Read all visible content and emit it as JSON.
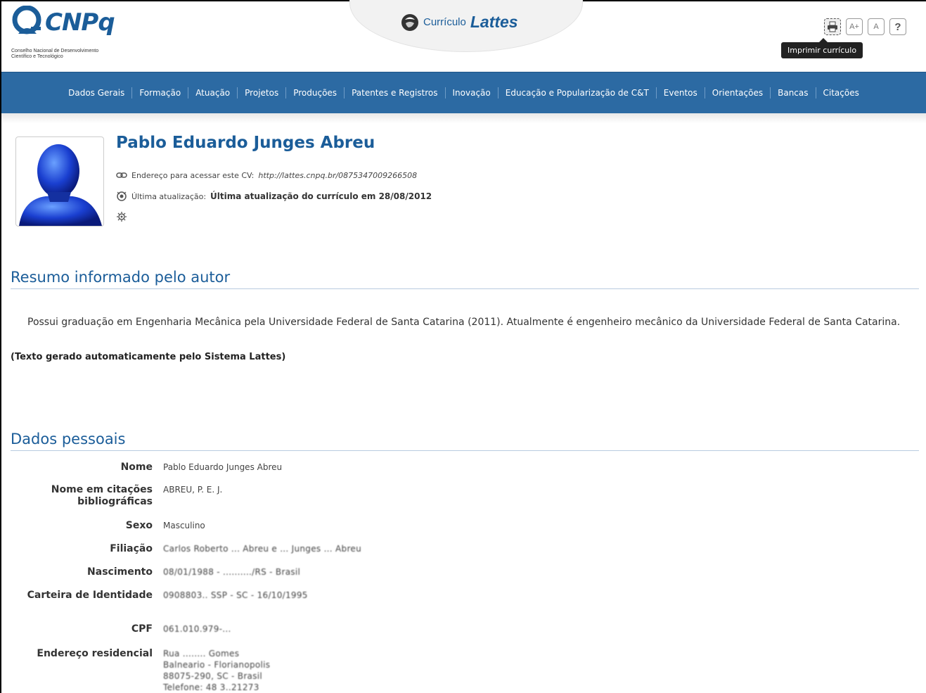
{
  "header": {
    "logo_text": "CNPq",
    "logo_subtitle_1": "Conselho Nacional de Desenvolvimento",
    "logo_subtitle_2": "Científico e Tecnológico",
    "app_title_prefix": "Currículo",
    "app_title_main": "Lattes",
    "tools": [
      {
        "name": "print",
        "label": ""
      },
      {
        "name": "font-increase",
        "label": "A+"
      },
      {
        "name": "font-default",
        "label": "A"
      },
      {
        "name": "help",
        "label": "?"
      }
    ],
    "tooltip": "Imprimir currículo"
  },
  "nav": {
    "items": [
      "Dados Gerais",
      "Formação",
      "Atuação",
      "Projetos",
      "Produções",
      "Patentes e Registros",
      "Inovação",
      "Educação e Popularização de C&T",
      "Eventos",
      "Orientações",
      "Bancas",
      "Citações"
    ]
  },
  "profile": {
    "name": "Pablo Eduardo Junges Abreu",
    "url_label": "Endereço para acessar este CV:",
    "url": "http://lattes.cnpq.br/0875347009266508",
    "update_label": "Última atualização:",
    "update_value": "Última atualização do currículo em 28/08/2012"
  },
  "resumo": {
    "title": "Resumo informado pelo autor",
    "text": "Possui graduação em Engenharia Mecânica pela Universidade Federal de Santa Catarina (2011). Atualmente é engenheiro mecânico da Universidade Federal de Santa Catarina.",
    "auto_note": "(Texto gerado automaticamente pelo Sistema Lattes)"
  },
  "dados": {
    "title": "Dados pessoais",
    "rows": [
      {
        "key": "Nome",
        "value": "Pablo Eduardo Junges Abreu"
      },
      {
        "key": "Nome em citações bibliográficas",
        "value": "ABREU, P. E. J."
      },
      {
        "key": "Sexo",
        "value": "Masculino"
      },
      {
        "key": "Filiação",
        "value": "Carlos Roberto ... Abreu e ... Junges ... Abreu"
      },
      {
        "key": "Nascimento",
        "value": "08/01/1988 - ........../RS - Brasil"
      },
      {
        "key": "Carteira de Identidade",
        "value": "0908803.. SSP - SC - 16/10/1995"
      },
      {
        "key": "CPF",
        "value": "061.010.979-..."
      },
      {
        "key": "Endereço residencial",
        "value_lines": [
          "Rua ........ Gomes",
          "Balneario - Florianopolis",
          "88075-290, SC - Brasil",
          "Telefone: 48 3..21273"
        ]
      }
    ]
  },
  "colors": {
    "brand": "#1b5d99",
    "nav_bg": "#2c6aa3"
  }
}
